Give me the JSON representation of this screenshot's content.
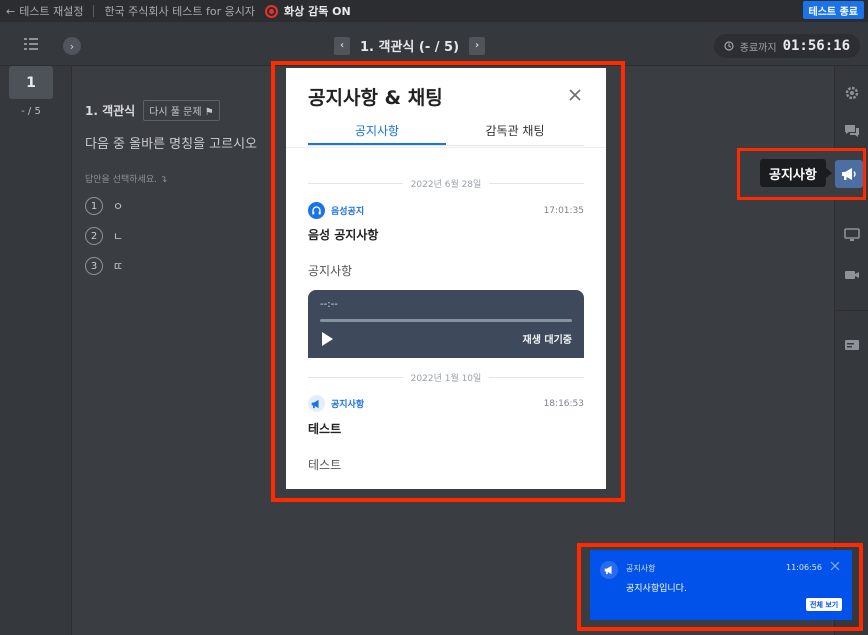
{
  "topbar": {
    "back_label": "테스트 재설정",
    "test_name": "한국 주식회사 테스트 for 응시자",
    "proctor_status": "화상 감독 ON",
    "end_button": "테스트 종료"
  },
  "nav": {
    "question_title": "1. 객관식 (- / 5)",
    "prev_arrow": "‹",
    "next_arrow": "›",
    "timer_label": "종료까지",
    "timer_value": "01:56:16"
  },
  "sidebar_left": {
    "current_number": "1",
    "progress": "- / 5"
  },
  "question": {
    "type_label": "1. 객관식",
    "review_label": "다시 풀 문제",
    "text": "다음 중 올바른 명칭을 고르시오",
    "hint": "답안을 선택하세요.",
    "options": [
      {
        "num": "1",
        "label": "ㅇ"
      },
      {
        "num": "2",
        "label": "ㄴ"
      },
      {
        "num": "3",
        "label": "ㄸ"
      }
    ]
  },
  "tooltip": {
    "label": "공지사항"
  },
  "modal": {
    "title": "공지사항 & 채팅",
    "tabs": [
      "공지사항",
      "감독관 채팅"
    ],
    "announcements": [
      {
        "date": "2022년 6월 28일",
        "type": "음성공지",
        "time": "17:01:35",
        "title": "음성 공지사항",
        "body": "공지사항",
        "player": {
          "time": "--:--",
          "status": "재생 대기중"
        }
      },
      {
        "date": "2022년 1월 10일",
        "type": "공지사항",
        "time": "18:16:53",
        "title": "테스트",
        "body": "테스트"
      }
    ]
  },
  "toast": {
    "type": "공지사항",
    "time": "11:06:56",
    "message": "공지사항입니다.",
    "button": "전체 보기"
  },
  "colors": {
    "accent": "#1a73e8",
    "highlight_frame": "#ff2a00",
    "toast_bg": "#0052ea",
    "record": "#e8312a"
  }
}
